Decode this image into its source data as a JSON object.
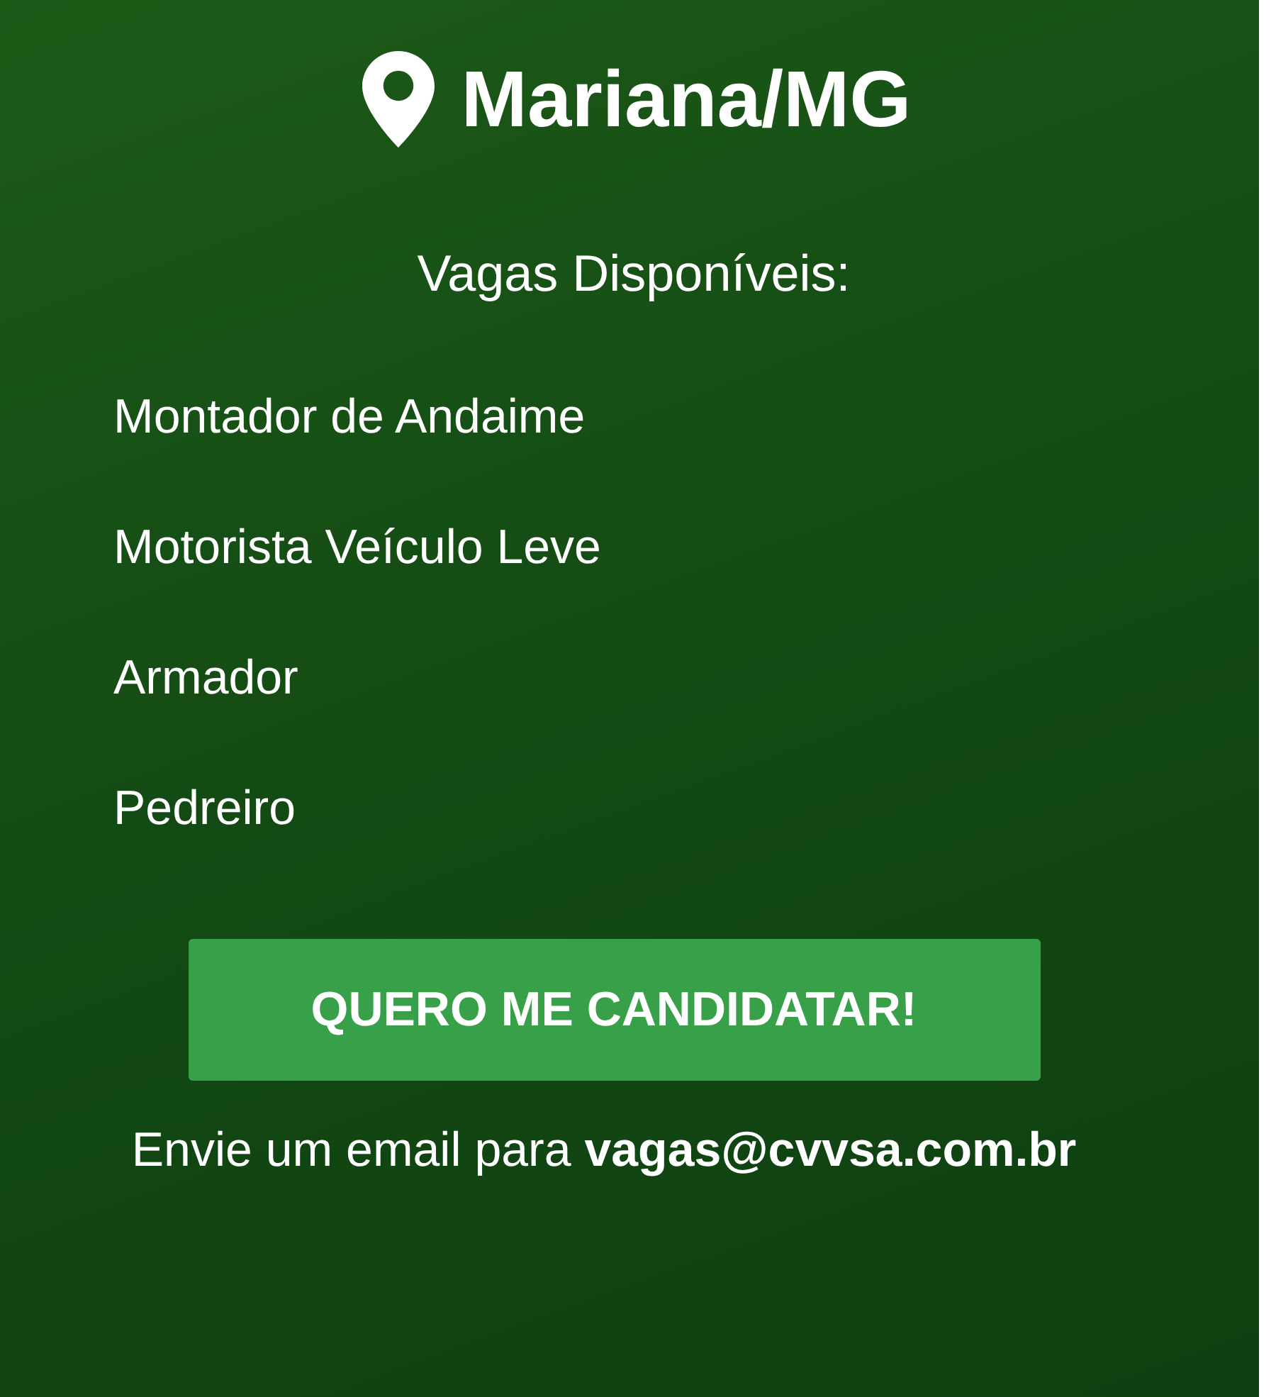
{
  "location": {
    "title": "Mariana/MG"
  },
  "heading": "Vagas Disponíveis:",
  "jobs": [
    "Montador de Andaime",
    "Motorista Veículo Leve",
    "Armador",
    "Pedreiro"
  ],
  "apply_button": "QUERO ME CANDIDATAR!",
  "contact": "Envie um email para **vagas@cvvsa.com.br**"
}
